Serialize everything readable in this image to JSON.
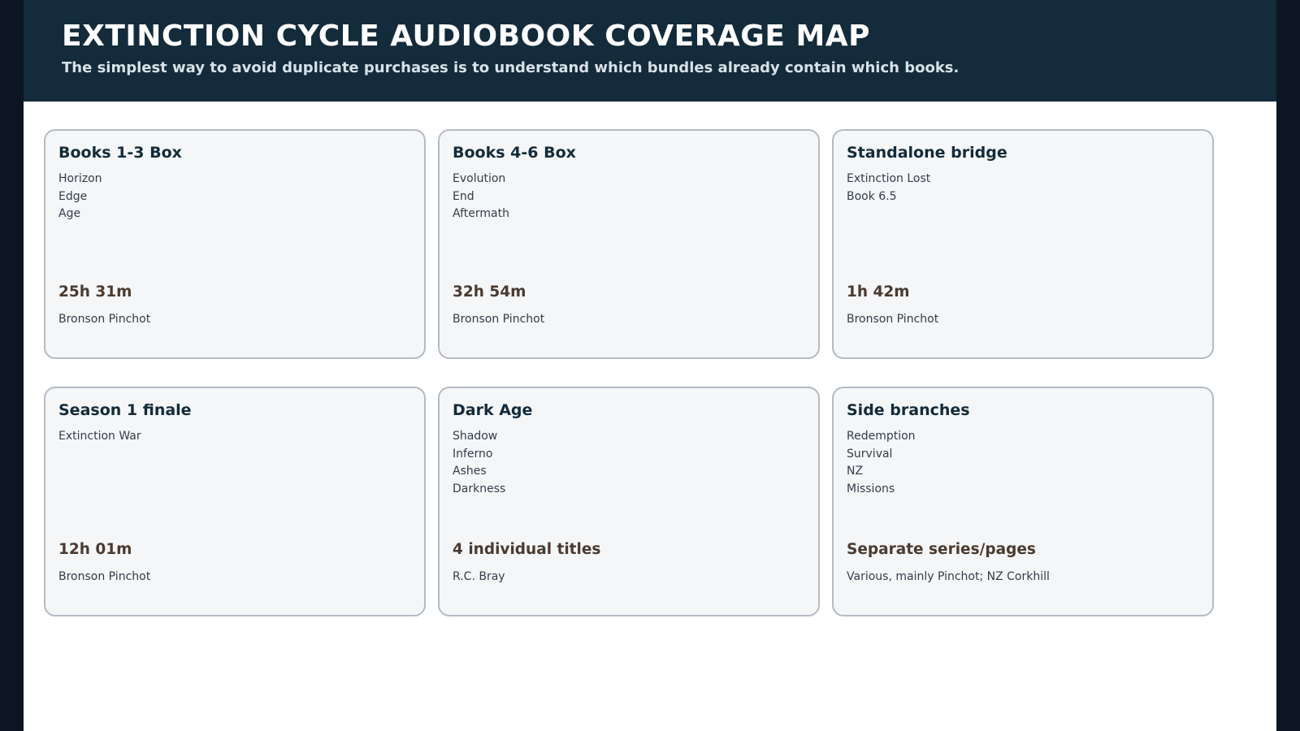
{
  "header": {
    "title": "EXTINCTION CYCLE AUDIOBOOK COVERAGE MAP",
    "subtitle": "The simplest way to avoid duplicate purchases is to understand which bundles already contain which books."
  },
  "colors": {
    "header_bg": "#132b3a",
    "card_bg": "#f4f6f8",
    "card_border": "#b3bbc3",
    "duration_text": "#4a3a2f",
    "outer_bg": "#0b1622"
  },
  "cards": [
    {
      "title": "Books 1-3 Box",
      "books": [
        "Horizon",
        "Edge",
        "Age"
      ],
      "duration": "25h 31m",
      "narrator": "Bronson Pinchot"
    },
    {
      "title": "Books 4-6 Box",
      "books": [
        "Evolution",
        "End",
        "Aftermath"
      ],
      "duration": "32h 54m",
      "narrator": "Bronson Pinchot"
    },
    {
      "title": "Standalone bridge",
      "books": [
        "Extinction Lost",
        "Book 6.5"
      ],
      "duration": "1h 42m",
      "narrator": "Bronson Pinchot"
    },
    {
      "title": "Season 1 finale",
      "books": [
        "Extinction War"
      ],
      "duration": "12h 01m",
      "narrator": "Bronson Pinchot"
    },
    {
      "title": "Dark Age",
      "books": [
        "Shadow",
        "Inferno",
        "Ashes",
        "Darkness"
      ],
      "duration": "4 individual titles",
      "narrator": "R.C. Bray"
    },
    {
      "title": "Side branches",
      "books": [
        "Redemption",
        "Survival",
        "NZ",
        "Missions"
      ],
      "duration": "Separate series/pages",
      "narrator": "Various, mainly Pinchot; NZ Corkhill"
    }
  ]
}
